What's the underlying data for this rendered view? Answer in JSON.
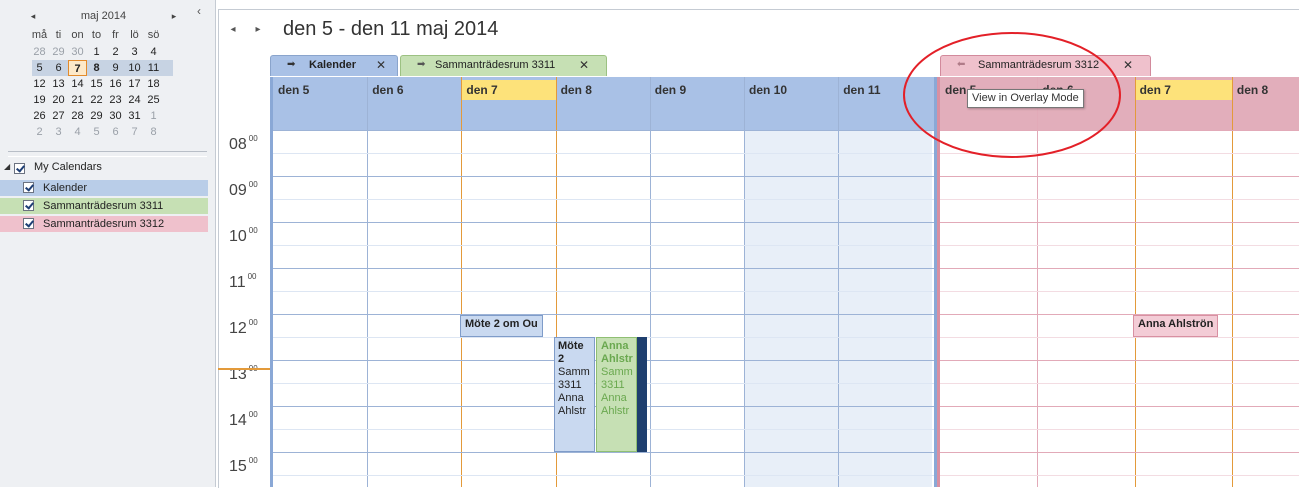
{
  "mini_calendar": {
    "month_label": "maj 2014",
    "prev": "◂",
    "next": "▸",
    "weekdays": [
      "må",
      "ti",
      "on",
      "to",
      "fr",
      "lö",
      "sö"
    ],
    "weeks": [
      [
        "28",
        "29",
        "30",
        "1",
        "2",
        "3",
        "4"
      ],
      [
        "5",
        "6",
        "7",
        "8",
        "9",
        "10",
        "11"
      ],
      [
        "12",
        "13",
        "14",
        "15",
        "16",
        "17",
        "18"
      ],
      [
        "19",
        "20",
        "21",
        "22",
        "23",
        "24",
        "25"
      ],
      [
        "26",
        "27",
        "28",
        "29",
        "30",
        "31",
        "1"
      ],
      [
        "2",
        "3",
        "4",
        "5",
        "6",
        "7",
        "8"
      ]
    ]
  },
  "calendars": {
    "group_label": "My Calendars",
    "items": [
      {
        "label": "Kalender",
        "color": "#b9cde8"
      },
      {
        "label": "Sammanträdesrum 3311",
        "color": "#c6e0b4"
      },
      {
        "label": "Sammanträdesrum 3312",
        "color": "#efc1cc"
      }
    ]
  },
  "header": {
    "range_title": "den 5 - den 11 maj 2014",
    "prev": "◂",
    "next": "▸"
  },
  "tabs": [
    {
      "label": "Kalender",
      "close": "✕"
    },
    {
      "label": "Sammanträdesrum 3311",
      "close": "✕"
    },
    {
      "label": "Sammanträdesrum 3312",
      "close": "✕"
    }
  ],
  "tooltip": "View in Overlay Mode",
  "days_a": [
    "den 5",
    "den 6",
    "den 7",
    "den 8",
    "den 9",
    "den 10",
    "den 11"
  ],
  "days_c": [
    "den 5",
    "den 6",
    "den 7",
    "den 8"
  ],
  "hours": [
    "08",
    "09",
    "10",
    "11",
    "12",
    "13",
    "14",
    "15"
  ],
  "minutes": "00",
  "appointments": {
    "a1": "Möte 2 om Ou",
    "a2": [
      "Möte",
      "2",
      "Samm",
      "3311",
      "Anna",
      "Ahlstr"
    ],
    "a3": [
      "Anna",
      "Ahlstr",
      "Samm",
      "3311",
      "Anna",
      "Ahlstr"
    ],
    "c1": "Anna Ahlströn"
  },
  "colors": {
    "blue": "#a9c1e6",
    "green": "#c6e0b4",
    "pink": "#e2aebb",
    "today": "#fde27a",
    "annotation": "#e32028"
  }
}
